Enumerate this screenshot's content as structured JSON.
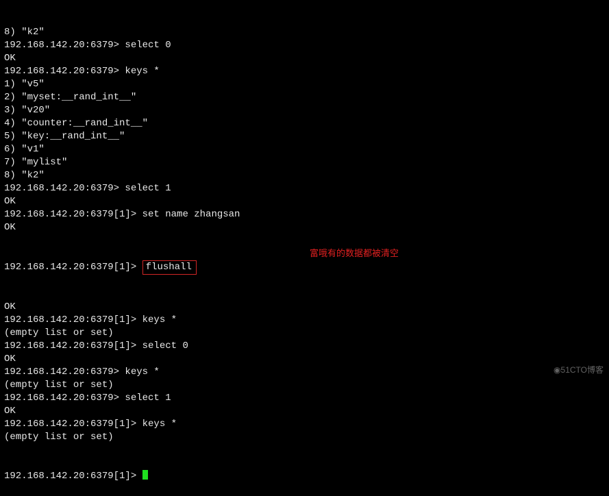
{
  "terminal": {
    "lines": [
      "8) \"k2\"",
      "192.168.142.20:6379> select 0",
      "OK",
      "192.168.142.20:6379> keys *",
      "1) \"v5\"",
      "2) \"myset:__rand_int__\"",
      "3) \"v20\"",
      "4) \"counter:__rand_int__\"",
      "5) \"key:__rand_int__\"",
      "6) \"v1\"",
      "7) \"mylist\"",
      "8) \"k2\"",
      "192.168.142.20:6379> select 1",
      "OK",
      "192.168.142.20:6379[1]> set name zhangsan",
      "OK"
    ],
    "highlight_prompt": "192.168.142.20:6379[1]> ",
    "highlight_cmd": "flushall",
    "after_highlight": [
      "OK",
      "192.168.142.20:6379[1]> keys *",
      "(empty list or set)",
      "192.168.142.20:6379[1]> select 0",
      "OK",
      "192.168.142.20:6379> keys *",
      "(empty list or set)",
      "192.168.142.20:6379> select 1",
      "OK",
      "192.168.142.20:6379[1]> keys *",
      "(empty list or set)"
    ],
    "cursor_prompt": "192.168.142.20:6379[1]> "
  },
  "annotation": "富哦有的数据都被清空",
  "watermark": "51CTO博客"
}
